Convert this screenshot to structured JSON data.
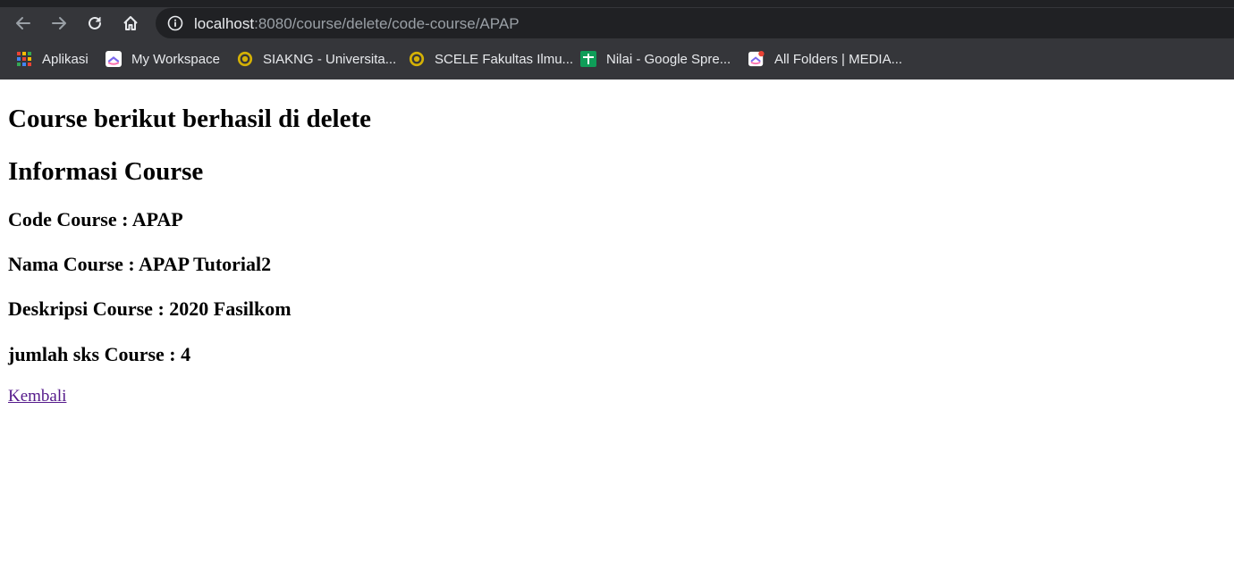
{
  "browser": {
    "url_host": "localhost",
    "url_rest": ":8080/course/delete/code-course/APAP",
    "bookmarks": [
      {
        "label": "Aplikasi",
        "icon": "apps-grid-icon"
      },
      {
        "label": "My Workspace",
        "icon": "clickup-icon"
      },
      {
        "label": "SIAKNG - Universita...",
        "icon": "ui-seal-icon"
      },
      {
        "label": "SCELE Fakultas Ilmu...",
        "icon": "ui-seal-icon"
      },
      {
        "label": "Nilai - Google Spre...",
        "icon": "google-sheets-icon"
      },
      {
        "label": "All Folders | MEDIA...",
        "icon": "clickup-notification-icon"
      }
    ]
  },
  "content": {
    "success_heading": "Course berikut berhasil di delete",
    "info_heading": "Informasi Course",
    "code_line": "Code Course : APAP",
    "name_line": "Nama Course : APAP Tutorial2",
    "desc_line": "Deskripsi Course : 2020 Fasilkom",
    "sks_line": "jumlah sks Course : 4",
    "back_link": "Kembali"
  },
  "colors": {
    "chrome_bg": "#35363a",
    "omnibox_bg": "#202124",
    "link_visited": "#551a8b"
  }
}
